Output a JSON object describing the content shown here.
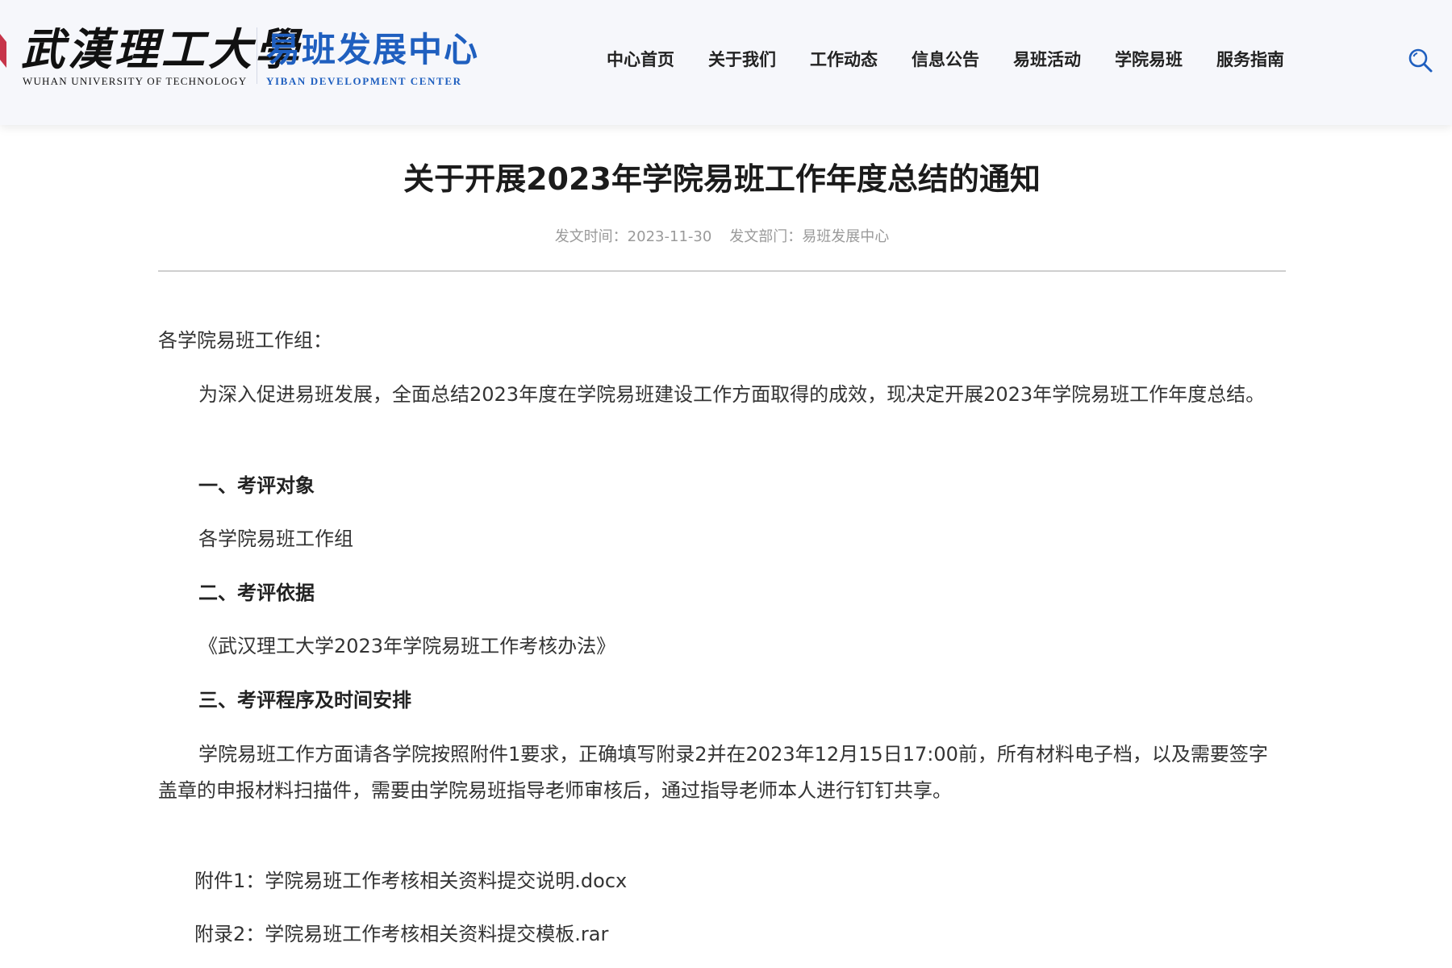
{
  "header": {
    "logo_cn": "武漢理工大學",
    "logo_en": "WUHAN UNIVERSITY OF TECHNOLOGY",
    "center_cn": "易班发展中心",
    "center_en": "YIBAN DEVELOPMENT CENTER",
    "nav": [
      "中心首页",
      "关于我们",
      "工作动态",
      "信息公告",
      "易班活动",
      "学院易班",
      "服务指南"
    ],
    "search_icon": "search-icon",
    "colors": {
      "brand_blue": "#1f5fbf",
      "header_bg": "#f6f7fb"
    }
  },
  "article": {
    "title": "关于开展2023年学院易班工作年度总结的通知",
    "meta": {
      "date": "发文时间：2023-11-30",
      "dept": "发文部门：易班发展中心"
    },
    "salutation": "各学院易班工作组：",
    "intro": "为深入促进易班发展，全面总结2023年度在学院易班建设工作方面取得的成效，现决定开展2023年学院易班工作年度总结。",
    "sections": [
      {
        "heading": "一、考评对象",
        "body": "各学院易班工作组"
      },
      {
        "heading": "二、考评依据",
        "body": "《武汉理工大学2023年学院易班工作考核办法》"
      },
      {
        "heading": "三、考评程序及时间安排",
        "body": "学院易班工作方面请各学院按照附件1要求，正确填写附录2并在2023年12月15日17:00前，所有材料电子档，以及需要签字盖章的申报材料扫描件，需要由学院易班指导老师审核后，通过指导老师本人进行钉钉共享。"
      }
    ],
    "attachments": [
      "附件1：学院易班工作考核相关资料提交说明.docx",
      "附录2：学院易班工作考核相关资料提交模板.rar"
    ]
  }
}
